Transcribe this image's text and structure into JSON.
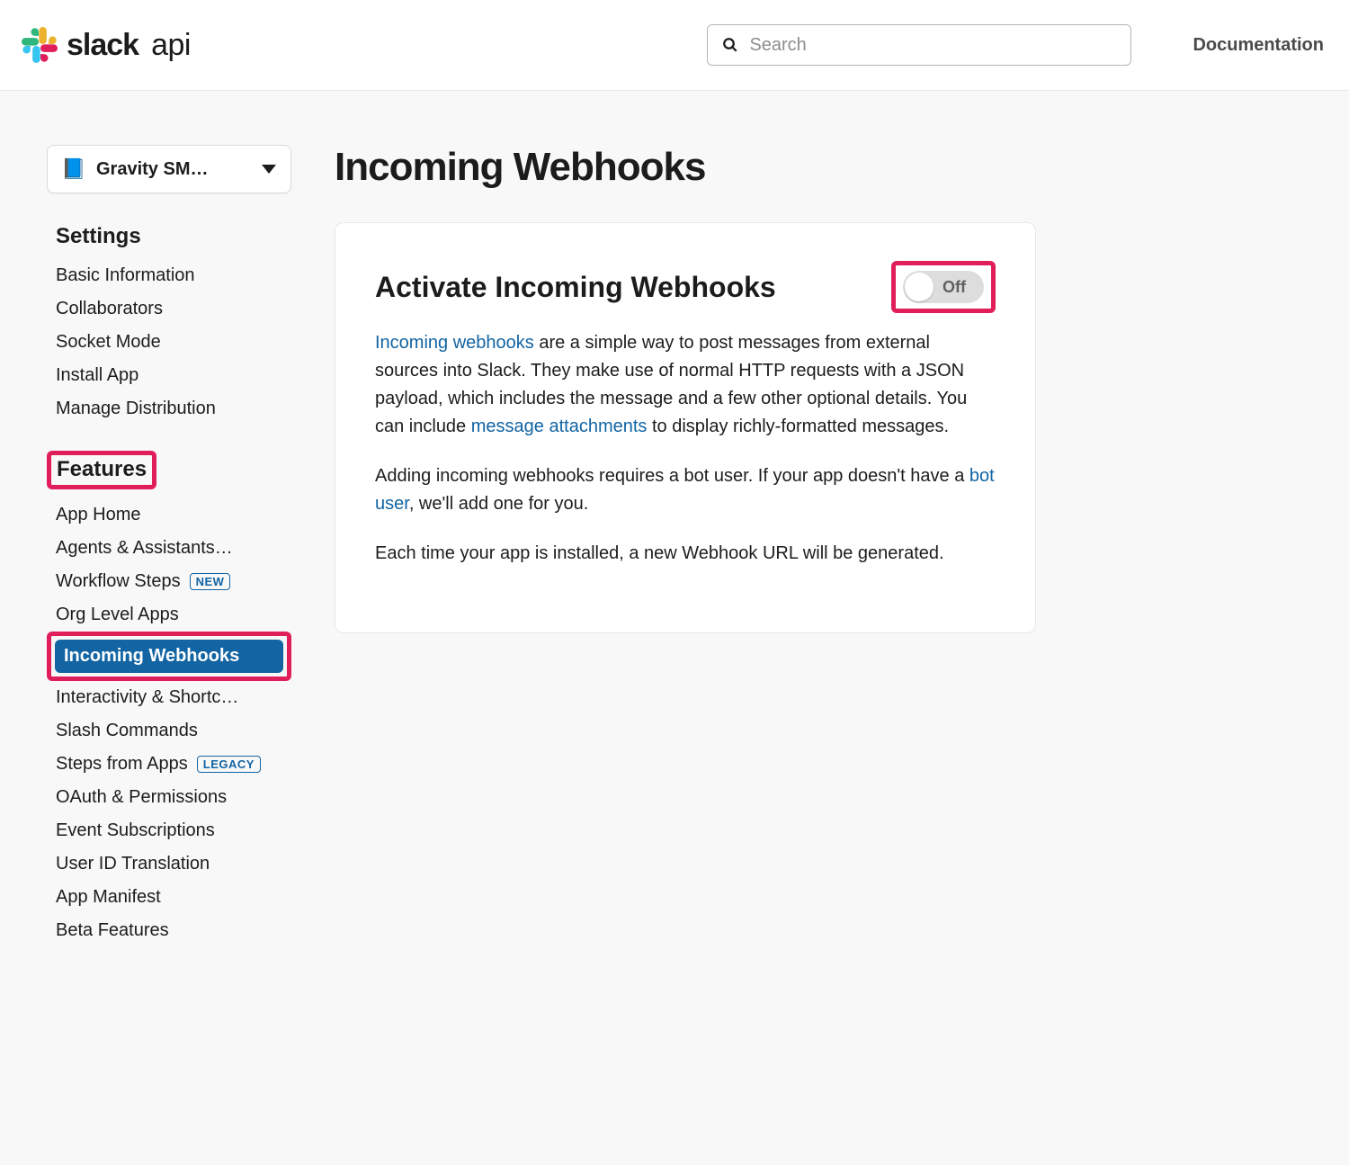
{
  "header": {
    "brand_main": "slack",
    "brand_suffix": "api",
    "search_placeholder": "Search",
    "documentation_label": "Documentation"
  },
  "sidebar": {
    "selected_app": "Gravity SM…",
    "sections": {
      "settings_header": "Settings",
      "features_header": "Features"
    },
    "settings_items": [
      "Basic Information",
      "Collaborators",
      "Socket Mode",
      "Install App",
      "Manage Distribution"
    ],
    "features_items": [
      "App Home",
      "Agents & Assistants…",
      "Workflow Steps",
      "Org Level Apps",
      "Incoming Webhooks",
      "Interactivity & Shortc…",
      "Slash Commands",
      "Steps from Apps",
      "OAuth & Permissions",
      "Event Subscriptions",
      "User ID Translation",
      "App Manifest",
      "Beta Features"
    ],
    "badge_new": "NEW",
    "badge_legacy": "LEGACY",
    "active_feature_index": 4
  },
  "main": {
    "page_title": "Incoming Webhooks",
    "card_title": "Activate Incoming Webhooks",
    "toggle_state": "Off",
    "p1_link1": "Incoming webhooks",
    "p1_t1": " are a simple way to post messages from external sources into Slack. They make use of normal HTTP requests with a JSON payload, which includes the message and a few other optional details. You can include ",
    "p1_link2": "message attachments",
    "p1_t2": " to display richly-formatted messages.",
    "p2_t1": "Adding incoming webhooks requires a bot user. If your app doesn't have a ",
    "p2_link1": "bot user",
    "p2_t2": ", we'll add one for you.",
    "p3": "Each time your app is installed, a new Webhook URL will be generated."
  }
}
